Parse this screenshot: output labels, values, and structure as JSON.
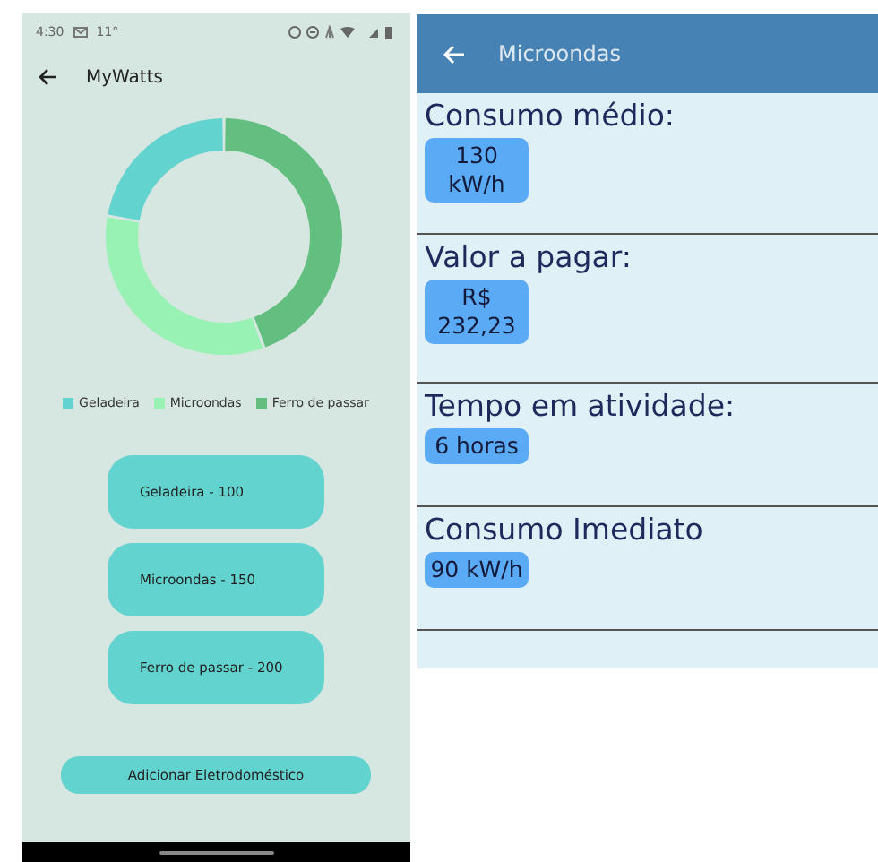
{
  "status_bar": {
    "time": "4:30",
    "temperature": "11°"
  },
  "app_bar": {
    "title": "MyWatts"
  },
  "chart": {
    "chart_data": {
      "type": "donut",
      "categories": [
        "Geladeira",
        "Microondas",
        "Ferro de passar"
      ],
      "series": [
        {
          "values": [
            22.2,
            33.3,
            44.5
          ]
        }
      ],
      "colors": [
        "#62d3cf",
        "#98f2b4",
        "#62bf7f"
      ]
    }
  },
  "appliances": [
    "Geladeira - 100",
    "Microondas - 150",
    "Ferro de passar - 200"
  ],
  "add_button": "Adicionar Eletrodoméstico",
  "detail": {
    "title": "Microondas",
    "sections": [
      {
        "label": "Consumo médio:",
        "value": "130 kW/h"
      },
      {
        "label": "Valor a pagar:",
        "value": "R$ 232,23"
      },
      {
        "label": "Tempo em atividade:",
        "value": "6 horas"
      },
      {
        "label": "Consumo Imediato",
        "value": "90 kW/h"
      }
    ]
  }
}
